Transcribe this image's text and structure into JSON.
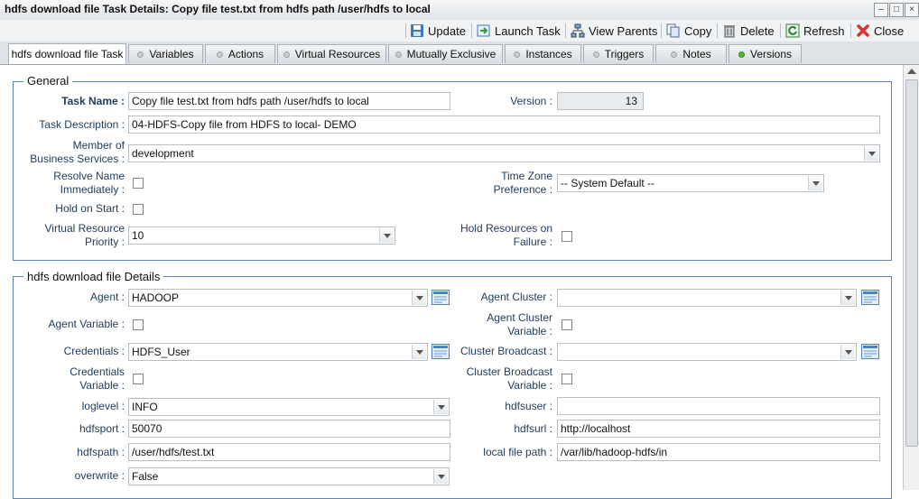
{
  "window": {
    "title": "hdfs download file Task Details: Copy file test.txt from hdfs path /user/hdfs to local"
  },
  "toolbar": {
    "update": "Update",
    "launch_task": "Launch Task",
    "view_parents": "View Parents",
    "copy": "Copy",
    "delete": "Delete",
    "refresh": "Refresh",
    "close": "Close"
  },
  "tabs": [
    "hdfs download file Task",
    "Variables",
    "Actions",
    "Virtual Resources",
    "Mutually Exclusive",
    "Instances",
    "Triggers",
    "Notes",
    "Versions"
  ],
  "general": {
    "legend": "General",
    "task_name_label": "Task Name :",
    "task_name": "Copy file test.txt from hdfs path /user/hdfs to local",
    "version_label": "Version :",
    "version": "13",
    "description_label": "Task Description :",
    "description": "04-HDFS-Copy file from HDFS to local- DEMO",
    "member_label_1": "Member of",
    "member_label_2": "Business Services :",
    "member": "development",
    "resolve_label_1": "Resolve Name",
    "resolve_label_2": "Immediately :",
    "timezone_label_1": "Time Zone",
    "timezone_label_2": "Preference :",
    "timezone": "-- System Default --",
    "hold_label": "Hold on Start :",
    "vr_priority_label_1": "Virtual Resource",
    "vr_priority_label_2": "Priority :",
    "vr_priority": "10",
    "hold_failure_label_1": "Hold Resources on",
    "hold_failure_label_2": "Failure :"
  },
  "details": {
    "legend": "hdfs download file Details",
    "agent_label": "Agent :",
    "agent": "HADOOP",
    "agent_cluster_label": "Agent Cluster :",
    "agent_cluster": "",
    "agent_variable_label": "Agent Variable :",
    "agent_cluster_variable_label_1": "Agent Cluster",
    "agent_cluster_variable_label_2": "Variable :",
    "credentials_label": "Credentials :",
    "credentials": "HDFS_User",
    "cluster_broadcast_label": "Cluster Broadcast :",
    "cluster_broadcast": "",
    "credentials_variable_label_1": "Credentials",
    "credentials_variable_label_2": "Variable :",
    "cluster_broadcast_variable_label_1": "Cluster Broadcast",
    "cluster_broadcast_variable_label_2": "Variable :",
    "loglevel_label": "loglevel :",
    "loglevel": "INFO",
    "hdfsuser_label": "hdfsuser :",
    "hdfsuser": "",
    "hdfsport_label": "hdfsport :",
    "hdfsport": "50070",
    "hdfsurl_label": "hdfsurl :",
    "hdfsurl": "http://localhost",
    "hdfspath_label": "hdfspath :",
    "hdfspath": "/user/hdfs/test.txt",
    "local_path_label": "local file path :",
    "local_path": "/var/lib/hadoop-hdfs/in",
    "overwrite_label": "overwrite :",
    "overwrite": "False"
  },
  "colors": {
    "accent": "#5e86b0",
    "label": "#1f3a5a",
    "close_red": "#d9362b",
    "version_dot": "#5bb338"
  }
}
